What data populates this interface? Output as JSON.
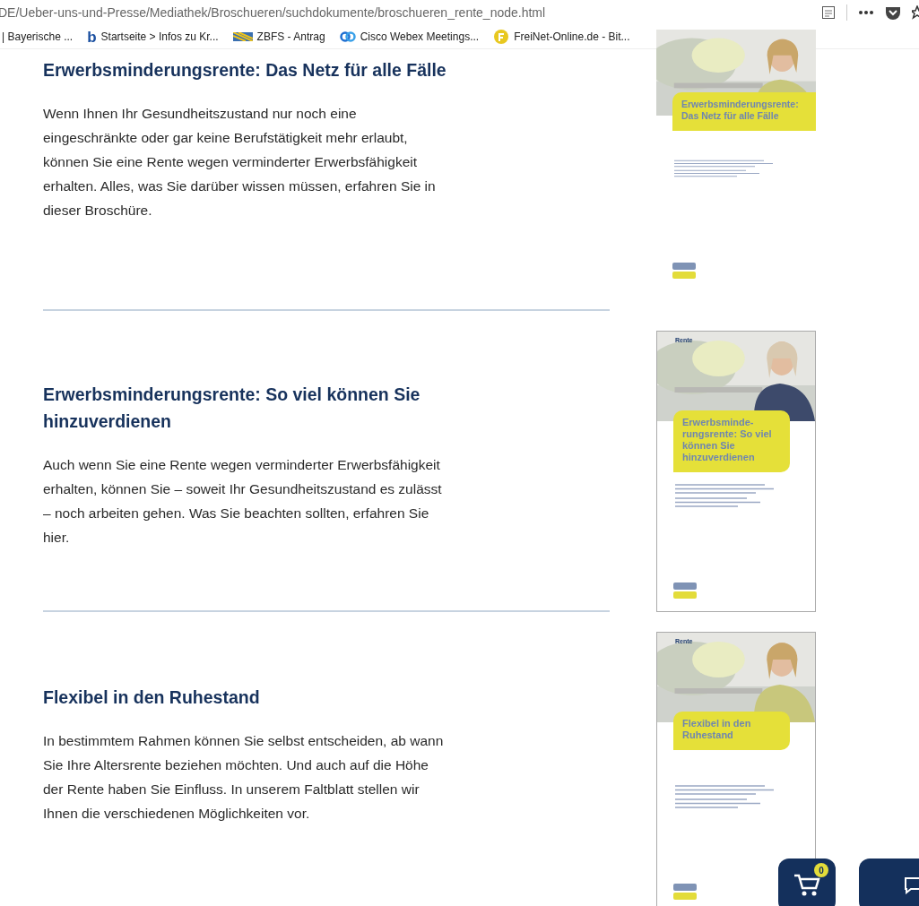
{
  "browser": {
    "url": "DE/Ueber-uns-und-Presse/Mediathek/Broschueren/suchdokumente/broschueren_rente_node.html",
    "bookmarks": [
      {
        "kind": "plain",
        "label": "| Bayerische ..."
      },
      {
        "kind": "letter",
        "icon_text": "b",
        "label": "Startseite > Infos zu Kr..."
      },
      {
        "kind": "flag",
        "label": "ZBFS - Antrag"
      },
      {
        "kind": "rings",
        "label": "Cisco Webex Meetings..."
      },
      {
        "kind": "circle",
        "label": "FreiNet-Online.de - Bit..."
      }
    ]
  },
  "sections": [
    {
      "title": "Erwerbsminderungsrente: Das Netz für alle Fälle",
      "text": "Wenn Ihnen Ihr Gesundheitszustand nur noch eine eingeschränkte oder gar keine Berufstätigkeit mehr erlaubt, können Sie eine Rente wegen verminderter Erwerbsfähigkeit erhalten. Alles, was Sie darüber wissen müssen, erfahren Sie in dieser Broschüre.",
      "cover": {
        "kind": "wide",
        "title": "Erwerbsminderungsrente: Das Netz für alle Fälle"
      }
    },
    {
      "title": "Erwerbsminderungsrente: So viel können Sie hinzuverdienen",
      "text": "Auch wenn Sie eine Rente wegen verminderter Erwerbsfähigkeit erhalten, können Sie – soweit Ihr Gesundheitszustand es zulässt – noch arbeiten gehen. Was Sie beachten sollten, erfahren Sie hier.",
      "cover": {
        "kind": "tall",
        "label": "Rente",
        "title": "Erwerbsminde-rungsrente: So viel können Sie hinzuverdienen"
      }
    },
    {
      "title": "Flexibel in den Ruhestand",
      "text": "In bestimmtem Rahmen können Sie selbst entscheiden, ab wann Sie Ihre Altersrente beziehen möchten. Und auch auf die Höhe der Rente haben Sie Einfluss. In unserem Faltblatt stellen wir Ihnen die verschiedenen Möglichkeiten vor.",
      "cover": {
        "kind": "tall",
        "label": "Rente",
        "title": "Flexibel in den Ruhestand"
      }
    }
  ],
  "cart": {
    "count": "0"
  }
}
